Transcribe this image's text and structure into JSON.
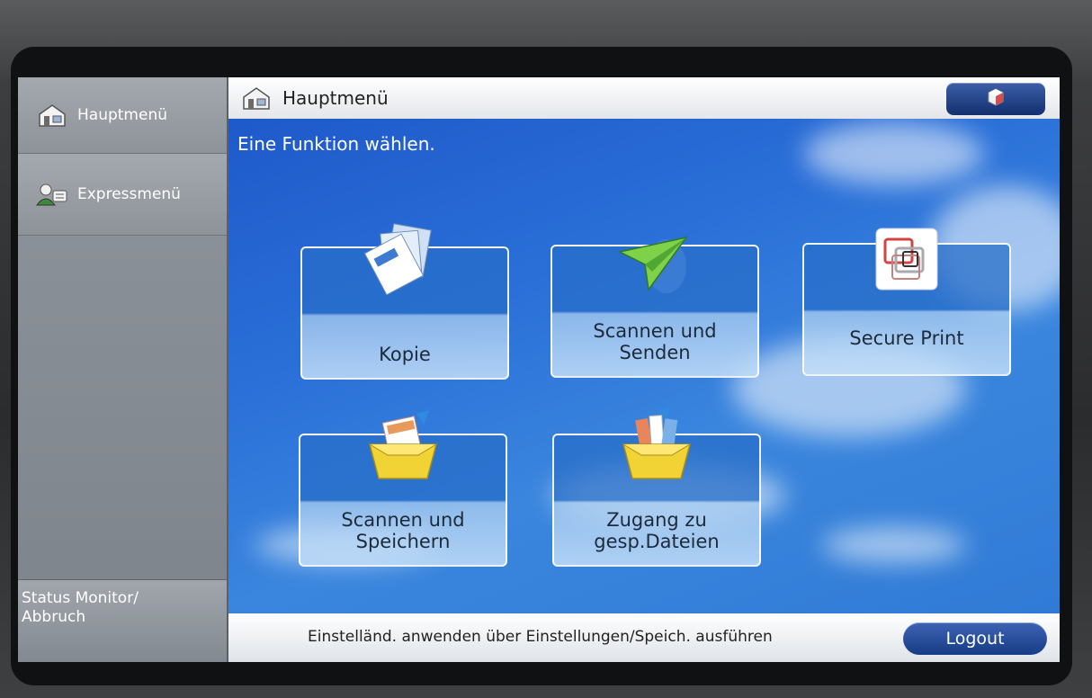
{
  "sidebar": {
    "items": [
      {
        "label": "Hauptmenü",
        "icon": "house-icon"
      },
      {
        "label": "Expressmenü",
        "icon": "users-icon"
      }
    ],
    "status": "Status Monitor/\nAbbruch"
  },
  "header": {
    "title": "Hauptmenü",
    "icon": "house-icon",
    "right_button_icon": "info-cube-icon"
  },
  "main": {
    "prompt": "Eine Funktion wählen.",
    "tiles": [
      {
        "label": "Kopie",
        "icon": "copy-icon"
      },
      {
        "label": "Scannen und\nSenden",
        "icon": "paper-plane-icon"
      },
      {
        "label": "Secure Print",
        "icon": "secure-print-icon"
      },
      {
        "label": "Scannen und\nSpeichern",
        "icon": "storage-box-icon"
      },
      {
        "label": "Zugang zu\ngesp.Dateien",
        "icon": "file-box-icon"
      }
    ]
  },
  "footer": {
    "message": "Einstelländ. anwenden über Einstellungen/Speich. ausführen",
    "logout_label": "Logout"
  },
  "colors": {
    "accent": "#163c86",
    "background": "#2a6fd8"
  }
}
